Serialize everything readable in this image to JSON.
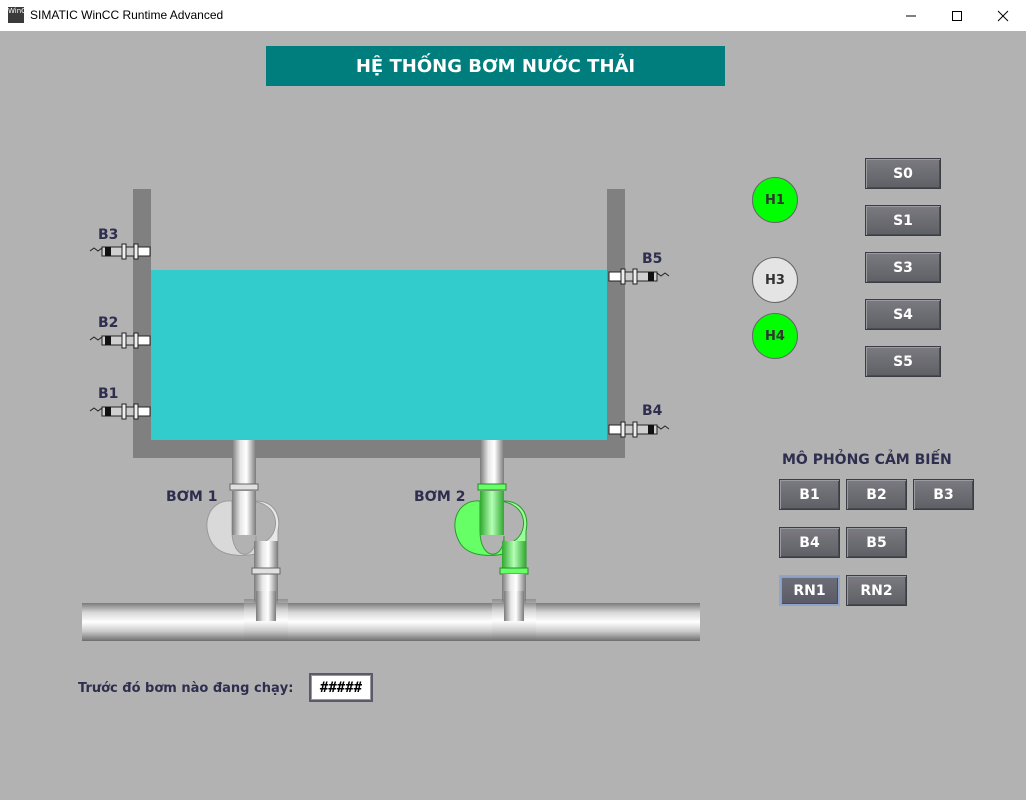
{
  "window": {
    "title": "SIMATIC WinCC Runtime Advanced",
    "icon_text": "WinCC",
    "controls": [
      "minimize-icon",
      "maximize-icon",
      "close-icon"
    ]
  },
  "header": {
    "title": "HỆ THỐNG BƠM NƯỚC THẢI"
  },
  "tank": {
    "water_color": "#33cccc",
    "wall_color": "#808080",
    "sensors_left": [
      "B3",
      "B2",
      "B1"
    ],
    "sensors_right": [
      "B5",
      "B4"
    ]
  },
  "pumps": [
    {
      "label": "BƠM 1",
      "state": "off",
      "color": "#d9d9d9"
    },
    {
      "label": "BƠM 2",
      "state": "on",
      "color": "#66ff66"
    }
  ],
  "lamps": [
    {
      "label": "H1",
      "state": "on",
      "color": "#00ff00"
    },
    {
      "label": "H3",
      "state": "off",
      "color": "#e4e4e4"
    },
    {
      "label": "H4",
      "state": "on",
      "color": "#00ff00"
    }
  ],
  "control_buttons": [
    "S0",
    "S1",
    "S3",
    "S4",
    "S5"
  ],
  "simulation": {
    "title": "MÔ PHỎNG CẢM BIẾN",
    "row1": [
      "B1",
      "B2",
      "B3"
    ],
    "row2": [
      "B4",
      "B5"
    ],
    "row3": [
      "RN1",
      "RN2"
    ]
  },
  "status": {
    "label": "Trước đó bơm nào đang chạy:",
    "value": "#####"
  }
}
